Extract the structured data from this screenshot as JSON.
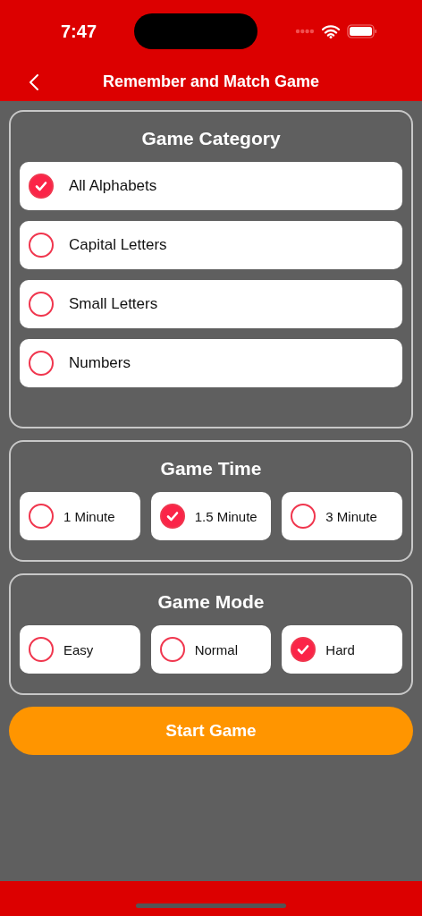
{
  "status_bar": {
    "time": "7:47"
  },
  "nav": {
    "title": "Remember and Match Game"
  },
  "sections": [
    {
      "title": "Game Category",
      "kind": "list",
      "options": [
        {
          "label": "All Alphabets",
          "selected": true
        },
        {
          "label": "Capital Letters",
          "selected": false
        },
        {
          "label": "Small Letters",
          "selected": false
        },
        {
          "label": "Numbers",
          "selected": false
        }
      ]
    },
    {
      "title": "Game Time",
      "kind": "row",
      "options": [
        {
          "label": "1 Minute",
          "selected": false
        },
        {
          "label": "1.5 Minute",
          "selected": true
        },
        {
          "label": "3 Minute",
          "selected": false
        }
      ]
    },
    {
      "title": "Game Mode",
      "kind": "row",
      "options": [
        {
          "label": "Easy",
          "selected": false
        },
        {
          "label": "Normal",
          "selected": false
        },
        {
          "label": "Hard",
          "selected": true
        }
      ]
    }
  ],
  "start_button": {
    "label": "Start Game"
  }
}
